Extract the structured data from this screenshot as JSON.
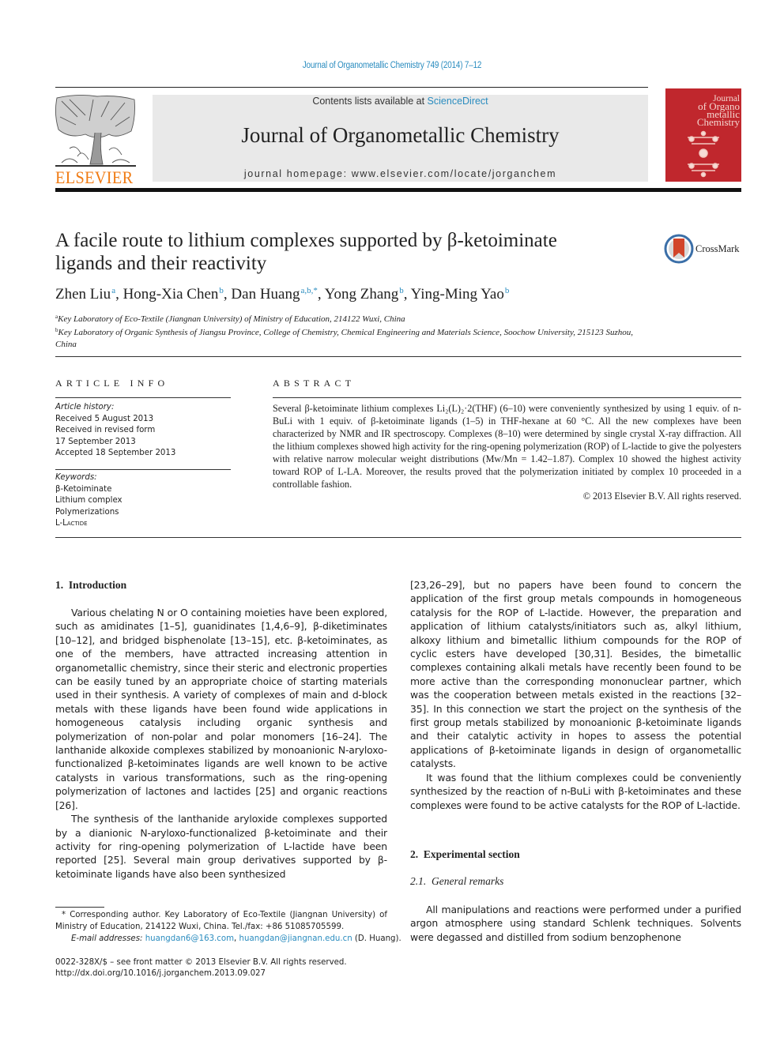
{
  "header": {
    "citation": "Journal of Organometallic Chemistry 749 (2014) 7–12",
    "contents_prefix": "Contents lists available at ",
    "contents_link": "ScienceDirect",
    "journal_name": "Journal of Organometallic Chemistry",
    "homepage_prefix": "journal homepage: ",
    "homepage_url": "www.elsevier.com/locate/jorganchem",
    "publisher_logo": "ELSEVIER",
    "cover_title_lines": [
      "Journal",
      "of Organo",
      "metallic",
      "Chemistry"
    ],
    "colors": {
      "link": "#2a8cbf",
      "elsevier_orange": "#f07a12",
      "cover_red": "#c0272d",
      "banner_gray": "#e9e9e9"
    }
  },
  "article": {
    "title_line1": "A facile route to lithium complexes supported by β-ketoiminate",
    "title_line2": "ligands and their reactivity",
    "crossmark_label": "CrossMark",
    "authors": [
      {
        "name": "Zhen Liu",
        "affil": "a"
      },
      {
        "name": "Hong-Xia Chen",
        "affil": "b"
      },
      {
        "name": "Dan Huang",
        "affil": "a,b,*"
      },
      {
        "name": "Yong Zhang",
        "affil": "b"
      },
      {
        "name": "Ying-Ming Yao",
        "affil": "b"
      }
    ],
    "affiliations": [
      {
        "mark": "a",
        "text": "Key Laboratory of Eco-Textile (Jiangnan University) of Ministry of Education, 214122 Wuxi, China"
      },
      {
        "mark": "b",
        "text": "Key Laboratory of Organic Synthesis of Jiangsu Province, College of Chemistry, Chemical Engineering and Materials Science, Soochow University, 215123 Suzhou, China"
      }
    ]
  },
  "article_info": {
    "heading": "ARTICLE INFO",
    "history_label": "Article history:",
    "history": [
      "Received 5 August 2013",
      "Received in revised form",
      "17 September 2013",
      "Accepted 18 September 2013"
    ],
    "keywords_label": "Keywords:",
    "keywords": [
      "β-Ketoiminate",
      "Lithium complex",
      "Polymerizations",
      "L-Lactide"
    ]
  },
  "abstract": {
    "heading": "ABSTRACT",
    "text": "Several β-ketoiminate lithium complexes Li₂(L)₂·2(THF) (6–10) were conveniently synthesized by using 1 equiv. of n-BuLi with 1 equiv. of β-ketoiminate ligands (1–5) in THF-hexane at 60 °C. All the new complexes have been characterized by NMR and IR spectroscopy. Complexes (8–10) were determined by single crystal X-ray diffraction. All the lithium complexes showed high activity for the ring-opening polymerization (ROP) of L-lactide to give the polyesters with relative narrow molecular weight distributions (Mw/Mn = 1.42–1.87). Complex 10 showed the highest activity toward ROP of L-LA. Moreover, the results proved that the polymerization initiated by complex 10 proceeded in a controllable fashion.",
    "copyright": "© 2013 Elsevier B.V. All rights reserved."
  },
  "body": {
    "sec1_heading": "1.  Introduction",
    "sec1_p1": "Various chelating N or O containing moieties have been explored, such as amidinates [1–5], guanidinates [1,4,6–9], β-diketiminates [10–12], and bridged bisphenolate [13–15], etc. β-ketoiminates, as one of the members, have attracted increasing attention in organometallic chemistry, since their steric and electronic properties can be easily tuned by an appropriate choice of starting materials used in their synthesis. A variety of complexes of main and d-block metals with these ligands have been found wide applications in homogeneous catalysis including organic synthesis and polymerization of non-polar and polar monomers [16–24]. The lanthanide alkoxide complexes stabilized by monoanionic N-aryloxo-functionalized β-ketoiminates ligands are well known to be active catalysts in various transformations, such as the ring-opening polymerization of lactones and lactides [25] and organic reactions [26].",
    "sec1_p2": "The synthesis of the lanthanide aryloxide complexes supported by a dianionic N-aryloxo-functionalized β-ketoiminate and their activity for ring-opening polymerization of L-lactide have been reported [25]. Several main group derivatives supported by β-ketoiminate ligands have also been synthesized",
    "col2_p1": "[23,26–29], but no papers have been found to concern the application of the first group metals compounds in homogeneous catalysis for the ROP of L-lactide. However, the preparation and application of lithium catalysts/initiators such as, alkyl lithium, alkoxy lithium and bimetallic lithium compounds for the ROP of cyclic esters have developed [30,31]. Besides, the bimetallic complexes containing alkali metals have recently been found to be more active than the corresponding mononuclear partner, which was the cooperation between metals existed in the reactions [32–35]. In this connection we start the project on the synthesis of the first group metals stabilized by monoanionic β-ketoiminate ligands and their catalytic activity in hopes to assess the potential applications of β-ketoiminate ligands in design of organometallic catalysts.",
    "col2_p2": "It was found that the lithium complexes could be conveniently synthesized by the reaction of n-BuLi with β-ketoiminates and these complexes were found to be active catalysts for the ROP of L-lactide.",
    "sec2_heading": "2.  Experimental section",
    "sec21_heading": "2.1.  General remarks",
    "sec21_p1": "All manipulations and reactions were performed under a purified argon atmosphere using standard Schlenk techniques. Solvents were degassed and distilled from sodium benzophenone"
  },
  "footnotes": {
    "corresponding": "* Corresponding author. Key Laboratory of Eco-Textile (Jiangnan University) of Ministry of Education, 214122 Wuxi, China. Tel./fax: +86 51085705599.",
    "email_label": "E-mail addresses: ",
    "email1": "huangdan6@163.com",
    "email2": "huangdan@jiangnan.edu.cn",
    "email_suffix": " (D. Huang).",
    "issn_line": "0022-328X/$ – see front matter © 2013 Elsevier B.V. All rights reserved.",
    "doi": "http://dx.doi.org/10.1016/j.jorganchem.2013.09.027"
  }
}
